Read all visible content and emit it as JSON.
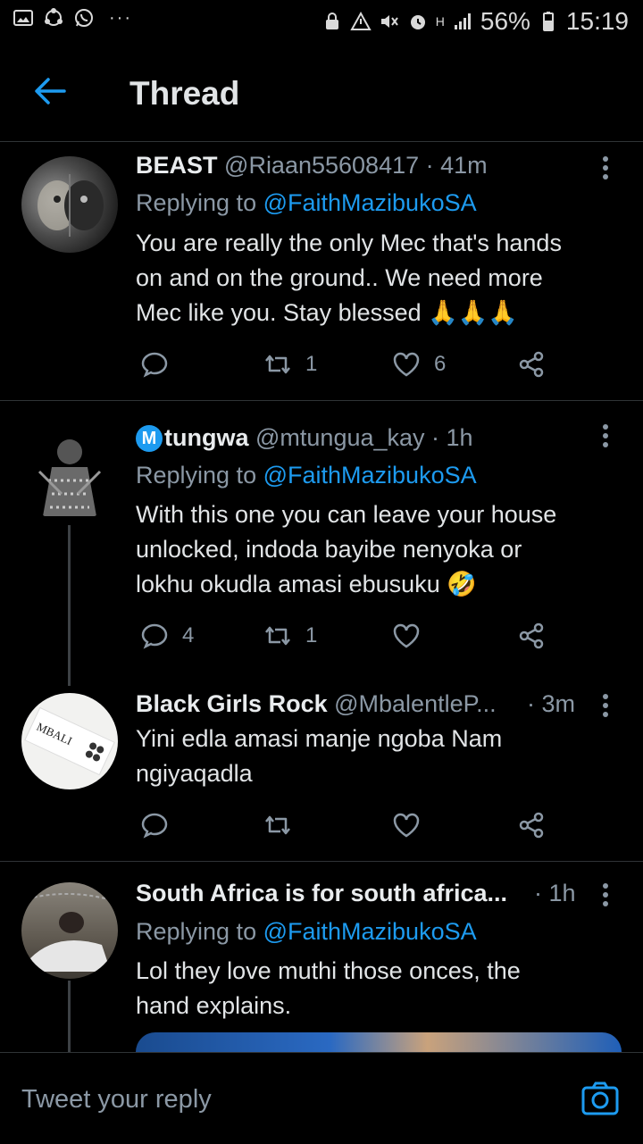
{
  "status_bar": {
    "battery": "56%",
    "time": "15:19",
    "network": "H",
    "dots": "···"
  },
  "header": {
    "title": "Thread"
  },
  "tweets": [
    {
      "name": "BEAST",
      "handle": "@Riaan55608417",
      "time": "· 41m",
      "replying_prefix": "Replying to ",
      "replying_to": "@FaithMazibukoSA",
      "body_lines": [
        "You are really the only Mec that's hands",
        "on and on the ground.. We need more",
        "Mec like you. Stay blessed 🙏🙏🙏"
      ],
      "replies": "",
      "retweets": "1",
      "likes": "6"
    },
    {
      "name_badge": "M",
      "name": "tungwa",
      "handle": "@mtungua_kay",
      "time": "· 1h",
      "replying_prefix": "Replying to ",
      "replying_to": "@FaithMazibukoSA",
      "body_lines": [
        "With this one you can leave your house",
        "unlocked, indoda bayibe nenyoka or",
        "lokhu okudla amasi ebusuku 🤣"
      ],
      "replies": "4",
      "retweets": "1",
      "likes": ""
    },
    {
      "name": "Black Girls Rock",
      "handle": "@MbalentleP...",
      "time": "· 3m",
      "avatar_text": "MBALI",
      "body_lines": [
        "Yini edla amasi manje ngoba Nam",
        "ngiyaqadla"
      ],
      "replies": "",
      "retweets": "",
      "likes": ""
    },
    {
      "name": "South Africa is for south africa...",
      "time": "· 1h",
      "replying_prefix": "Replying to ",
      "replying_to": "@FaithMazibukoSA",
      "body_lines": [
        "Lol they love muthi those onces, the",
        "hand explains."
      ]
    }
  ],
  "reply_bar": {
    "placeholder": "Tweet your reply"
  },
  "colors": {
    "background": "#000000",
    "accent": "#1d9bf0",
    "muted_text": "#8b98a5",
    "divider": "#2f3336"
  }
}
